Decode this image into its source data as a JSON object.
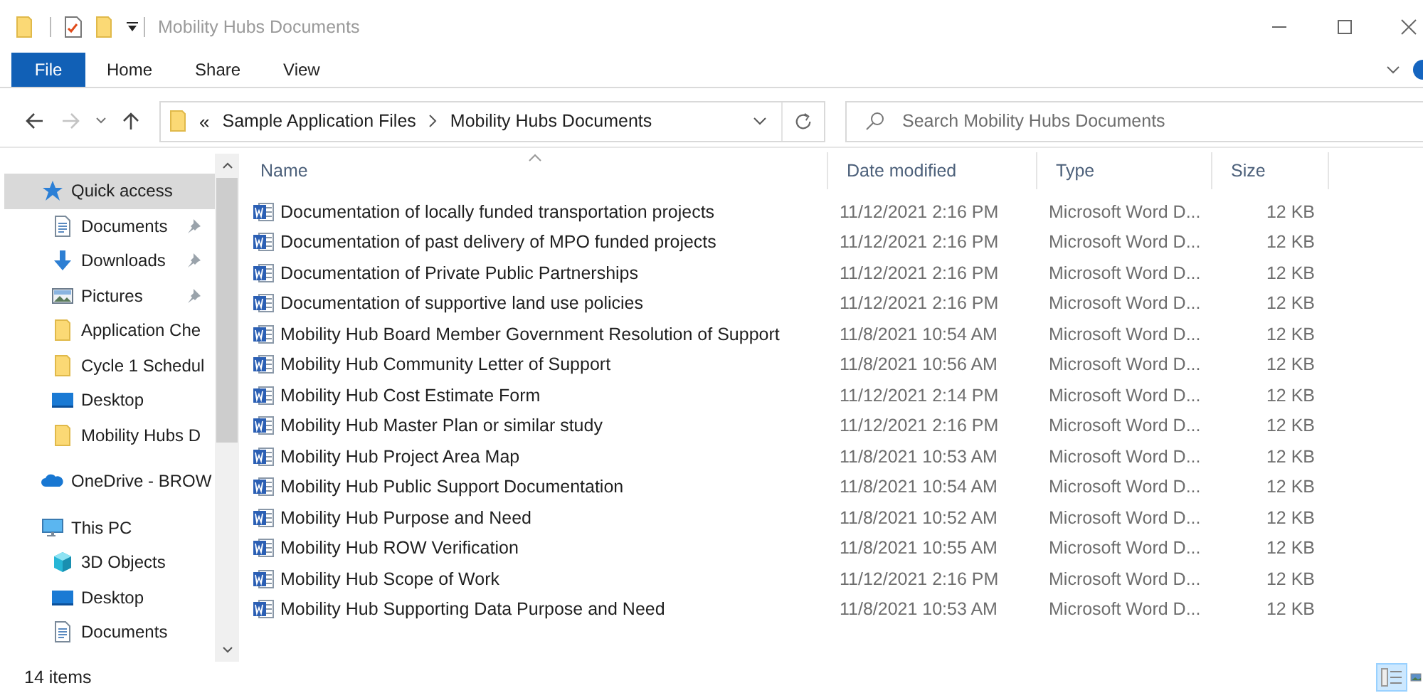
{
  "window": {
    "title": "Mobility Hubs Documents",
    "active": false
  },
  "ribbon": {
    "tabs": [
      {
        "label": "File",
        "kind": "file"
      },
      {
        "label": "Home",
        "kind": "tab"
      },
      {
        "label": "Share",
        "kind": "tab"
      },
      {
        "label": "View",
        "kind": "tab"
      }
    ]
  },
  "navigation": {
    "back_enabled": true,
    "forward_enabled": false
  },
  "address_bar": {
    "overflow_marker": "«",
    "segments": [
      "Sample Application Files",
      "Mobility Hubs Documents"
    ]
  },
  "search": {
    "placeholder": "Search Mobility Hubs Documents"
  },
  "navigation_pane": [
    {
      "label": "Quick access",
      "kind": "star",
      "selected": true,
      "children": [
        {
          "label": "Documents",
          "kind": "documents",
          "pinned": true,
          "selected": false
        },
        {
          "label": "Downloads",
          "kind": "download",
          "pinned": true,
          "selected": false
        },
        {
          "label": "Pictures",
          "kind": "pictures",
          "pinned": true,
          "selected": false
        },
        {
          "label": "Application Che",
          "kind": "folder",
          "pinned": false,
          "selected": false
        },
        {
          "label": "Cycle 1 Schedul",
          "kind": "folder",
          "pinned": false,
          "selected": false
        },
        {
          "label": "Desktop",
          "kind": "desktop",
          "pinned": false,
          "selected": false
        },
        {
          "label": "Mobility Hubs D",
          "kind": "folder",
          "pinned": false,
          "selected": false
        }
      ]
    },
    {
      "label": "OneDrive - BROW",
      "kind": "cloud",
      "selected": false
    },
    {
      "label": "This PC",
      "kind": "pc",
      "selected": false,
      "children": [
        {
          "label": "3D Objects",
          "kind": "cube",
          "pinned": false,
          "selected": false
        },
        {
          "label": "Desktop",
          "kind": "desktop",
          "pinned": false,
          "selected": false
        },
        {
          "label": "Documents",
          "kind": "documents",
          "pinned": false,
          "selected": false
        }
      ]
    }
  ],
  "table": {
    "columns": [
      {
        "label": "Name",
        "sorted": true
      },
      {
        "label": "Date modified",
        "sorted": false
      },
      {
        "label": "Type",
        "sorted": false
      },
      {
        "label": "Size",
        "sorted": false
      }
    ],
    "rows": [
      {
        "name": "Documentation of locally funded transportation projects",
        "date_modified": "11/12/2021 2:16 PM",
        "type": "Microsoft Word D...",
        "size": "12 KB"
      },
      {
        "name": "Documentation of past delivery of MPO funded projects",
        "date_modified": "11/12/2021 2:16 PM",
        "type": "Microsoft Word D...",
        "size": "12 KB"
      },
      {
        "name": "Documentation of Private Public Partnerships",
        "date_modified": "11/12/2021 2:16 PM",
        "type": "Microsoft Word D...",
        "size": "12 KB"
      },
      {
        "name": "Documentation of supportive land use policies",
        "date_modified": "11/12/2021 2:16 PM",
        "type": "Microsoft Word D...",
        "size": "12 KB"
      },
      {
        "name": "Mobility Hub Board Member Government Resolution of Support",
        "date_modified": "11/8/2021 10:54 AM",
        "type": "Microsoft Word D...",
        "size": "12 KB"
      },
      {
        "name": "Mobility Hub Community Letter of Support",
        "date_modified": "11/8/2021 10:56 AM",
        "type": "Microsoft Word D...",
        "size": "12 KB"
      },
      {
        "name": "Mobility Hub Cost Estimate Form",
        "date_modified": "11/12/2021 2:14 PM",
        "type": "Microsoft Word D...",
        "size": "12 KB"
      },
      {
        "name": "Mobility Hub Master Plan or similar study",
        "date_modified": "11/12/2021 2:16 PM",
        "type": "Microsoft Word D...",
        "size": "12 KB"
      },
      {
        "name": "Mobility Hub Project Area Map",
        "date_modified": "11/8/2021 10:53 AM",
        "type": "Microsoft Word D...",
        "size": "12 KB"
      },
      {
        "name": "Mobility Hub Public Support Documentation",
        "date_modified": "11/8/2021 10:54 AM",
        "type": "Microsoft Word D...",
        "size": "12 KB"
      },
      {
        "name": "Mobility Hub Purpose and Need",
        "date_modified": "11/8/2021 10:52 AM",
        "type": "Microsoft Word D...",
        "size": "12 KB"
      },
      {
        "name": "Mobility Hub ROW Verification",
        "date_modified": "11/8/2021 10:55 AM",
        "type": "Microsoft Word D...",
        "size": "12 KB"
      },
      {
        "name": "Mobility Hub Scope of Work",
        "date_modified": "11/12/2021 2:16 PM",
        "type": "Microsoft Word D...",
        "size": "12 KB"
      },
      {
        "name": "Mobility Hub Supporting Data Purpose and Need",
        "date_modified": "11/8/2021 10:53 AM",
        "type": "Microsoft Word D...",
        "size": "12 KB"
      }
    ]
  },
  "status_bar": {
    "item_count": "14 items",
    "views": [
      {
        "kind": "details",
        "selected": true
      },
      {
        "kind": "large-icons",
        "selected": false
      }
    ]
  }
}
